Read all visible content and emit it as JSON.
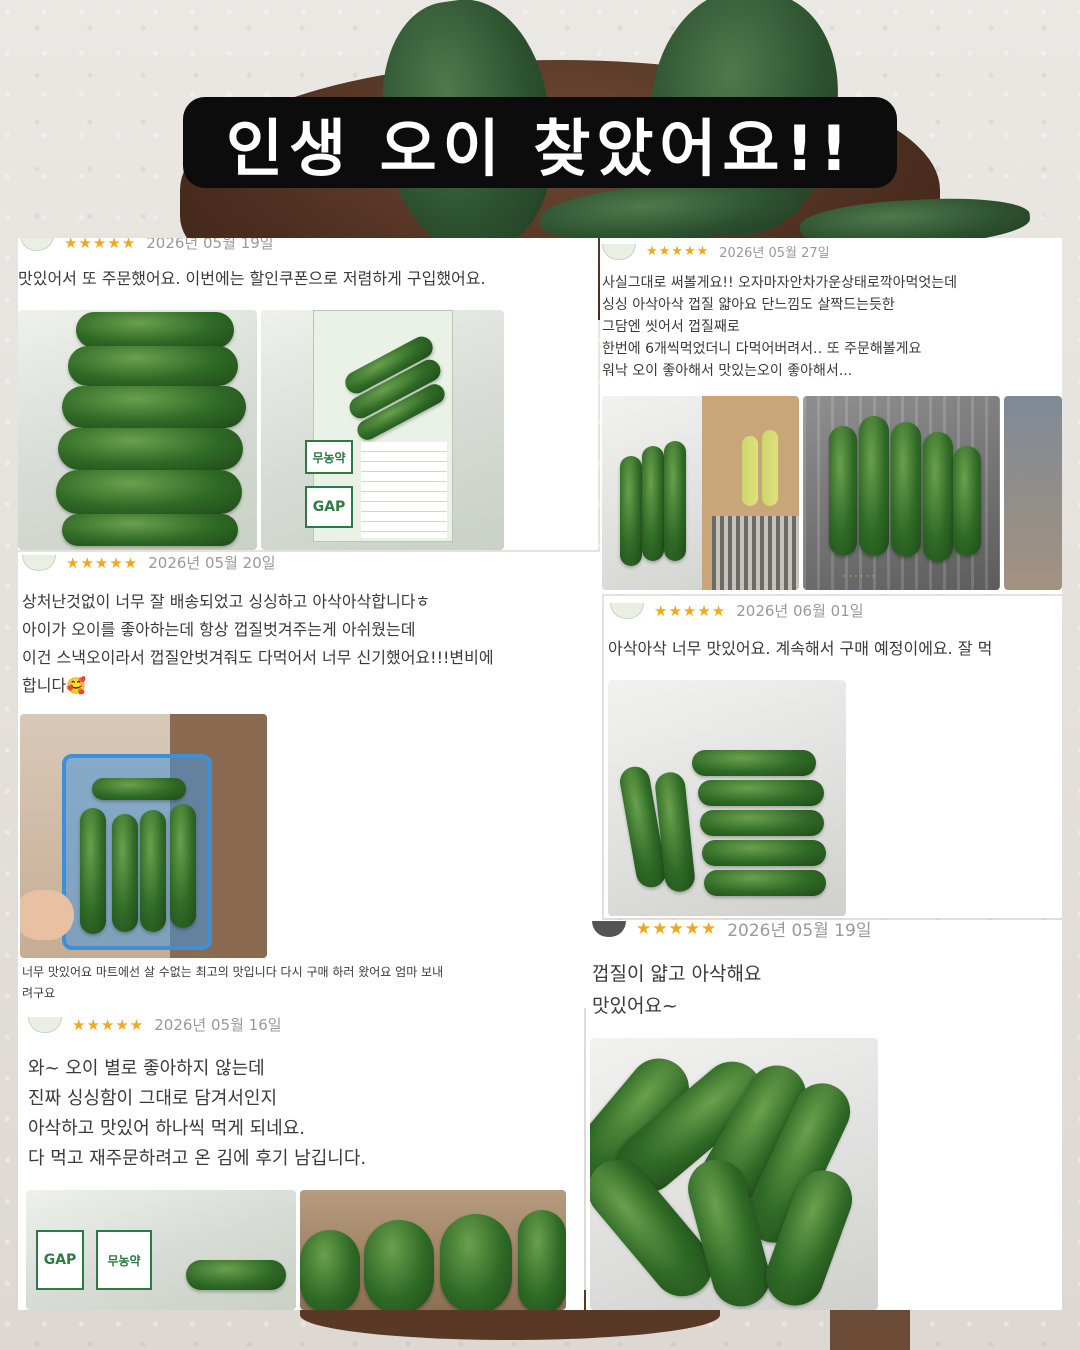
{
  "title": "인생 오이 찾았어요!!",
  "reviews": [
    {
      "stars": "★★★★★",
      "date": "2026년 05월 19일",
      "text": "맛있어서 또 주문했어요. 이번에는 할인쿠폰으로 저렴하게 구입했어요."
    },
    {
      "stars": "★★★★★",
      "date": "2026년 05월 27일",
      "text": "사실그대로 써볼게요!! 오자마자안차가운상태로깍아먹엇는데\n싱싱 아삭아삭 껍질 얇아요 단느낌도 살짝드는듯한\n그담엔 씻어서 껍질째로\n한번에 6개씩먹었더니 다먹어버려서‥ 또 주문해볼게요\n워낙 오이 좋아해서 맛있는오이 좋아해서..."
    },
    {
      "stars": "★★★★★",
      "date": "2026년 05월 20일",
      "text": "상처난것없이 너무 잘 배송되었고 싱싱하고 아삭아삭합니다ㅎ\n아이가 오이를 좋아하는데 항상 껍질벗겨주는게 아쉬웠는데\n이건 스낵오이라서 껍질안벗겨줘도 다먹어서 너무 신기했어요!!!변비에\n합니다🥰"
    },
    {
      "stars": "★★★★★",
      "date": "2026년 06월 01일",
      "text": "아삭아삭 너무 맛있어요. 계속해서 구매 예정이에요. 잘 먹"
    },
    {
      "stars": "",
      "date": "",
      "text": "너무 맛있어요 마트에선 살 수없는 최고의 맛입니다 다시 구매 하러 왔어요 엄마 보내\n려구요"
    },
    {
      "stars": "★★★★★",
      "date": "2026년 05월 19일",
      "text": "껍질이 얇고 아삭해요\n맛있어요~"
    },
    {
      "stars": "★★★★★",
      "date": "2026년 05월 16일",
      "text": "와~ 오이 별로 좋아하지 않는데\n진짜 싱싱함이 그대로 담겨서인지\n아삭하고 맛있어 하나씩 먹게 되네요.\n다 먹고 재주문하려고 온 김에 후기 남깁니다."
    }
  ],
  "labels": {
    "organic": "무농약",
    "gap": "GAP"
  },
  "colors": {
    "star": "#f2a81d",
    "banner": "#0c0c0c",
    "cucumber": "#2f6a26"
  }
}
